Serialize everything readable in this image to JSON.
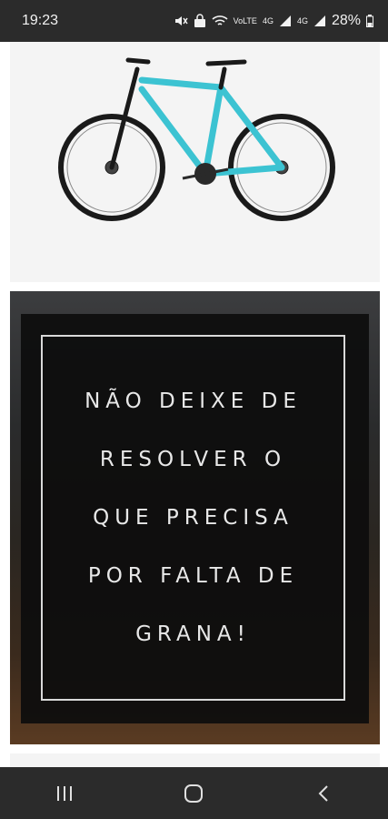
{
  "status_bar": {
    "time": "19:23",
    "indicators": [
      "mute-icon",
      "vpn-icon",
      "wifi-icon",
      "volte-icon",
      "signal-icon",
      "signal-icon"
    ],
    "volte_label": "VoLTE",
    "network_label_1": "4G",
    "network_label_2": "4G",
    "battery": "28%"
  },
  "product_image": {
    "description_icon": "bicycle-icon",
    "frame_color": "#3cc3d2"
  },
  "promo_banner": {
    "lines": [
      "NÃO DEIXE DE",
      "RESOLVER O",
      "QUE PRECISA",
      "POR FALTA DE",
      "GRANA!"
    ]
  },
  "nav_bar": {
    "recents": "recent-apps-icon",
    "home": "home-icon",
    "back": "back-icon"
  },
  "colors": {
    "bars": "#2b2b2b",
    "card_bg": "#f4f4f4"
  }
}
